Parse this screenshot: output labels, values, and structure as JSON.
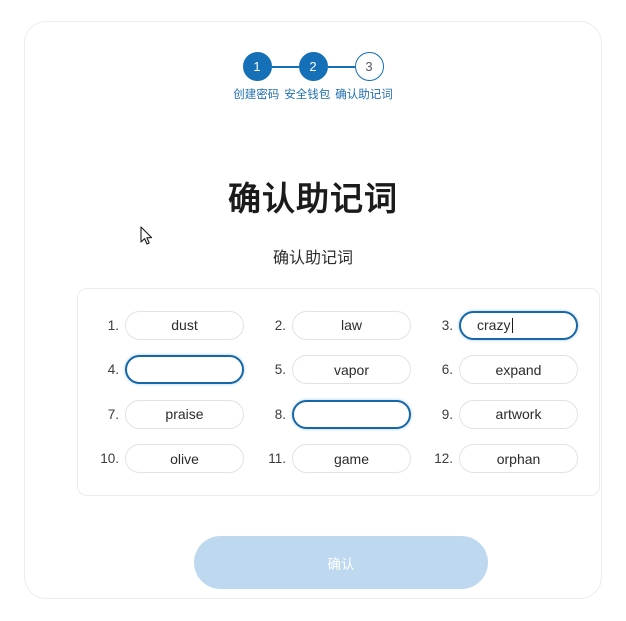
{
  "stepper": {
    "steps": [
      {
        "number": "1",
        "label": "创建密码",
        "state": "done"
      },
      {
        "number": "2",
        "label": "安全钱包",
        "state": "done"
      },
      {
        "number": "3",
        "label": "确认助记词",
        "state": "todo"
      }
    ]
  },
  "headings": {
    "title": "确认助记词",
    "subtitle": "确认助记词"
  },
  "mnemonic": {
    "words": [
      {
        "index": "1.",
        "value": "dust",
        "focused": false
      },
      {
        "index": "2.",
        "value": "law",
        "focused": false
      },
      {
        "index": "3.",
        "value": "crazy",
        "focused": true
      },
      {
        "index": "4.",
        "value": "",
        "focused": true
      },
      {
        "index": "5.",
        "value": "vapor",
        "focused": false
      },
      {
        "index": "6.",
        "value": "expand",
        "focused": false
      },
      {
        "index": "7.",
        "value": "praise",
        "focused": false
      },
      {
        "index": "8.",
        "value": "",
        "focused": true
      },
      {
        "index": "9.",
        "value": "artwork",
        "focused": false
      },
      {
        "index": "10.",
        "value": "olive",
        "focused": false
      },
      {
        "index": "11.",
        "value": "game",
        "focused": false
      },
      {
        "index": "12.",
        "value": "orphan",
        "focused": false
      }
    ]
  },
  "actions": {
    "confirm_label": "确认"
  },
  "colors": {
    "accent": "#1570b8",
    "focus_border": "#1668a8",
    "button_disabled": "#bed9ef",
    "card_border": "#ececec",
    "step_label": "#1f6fb2"
  }
}
